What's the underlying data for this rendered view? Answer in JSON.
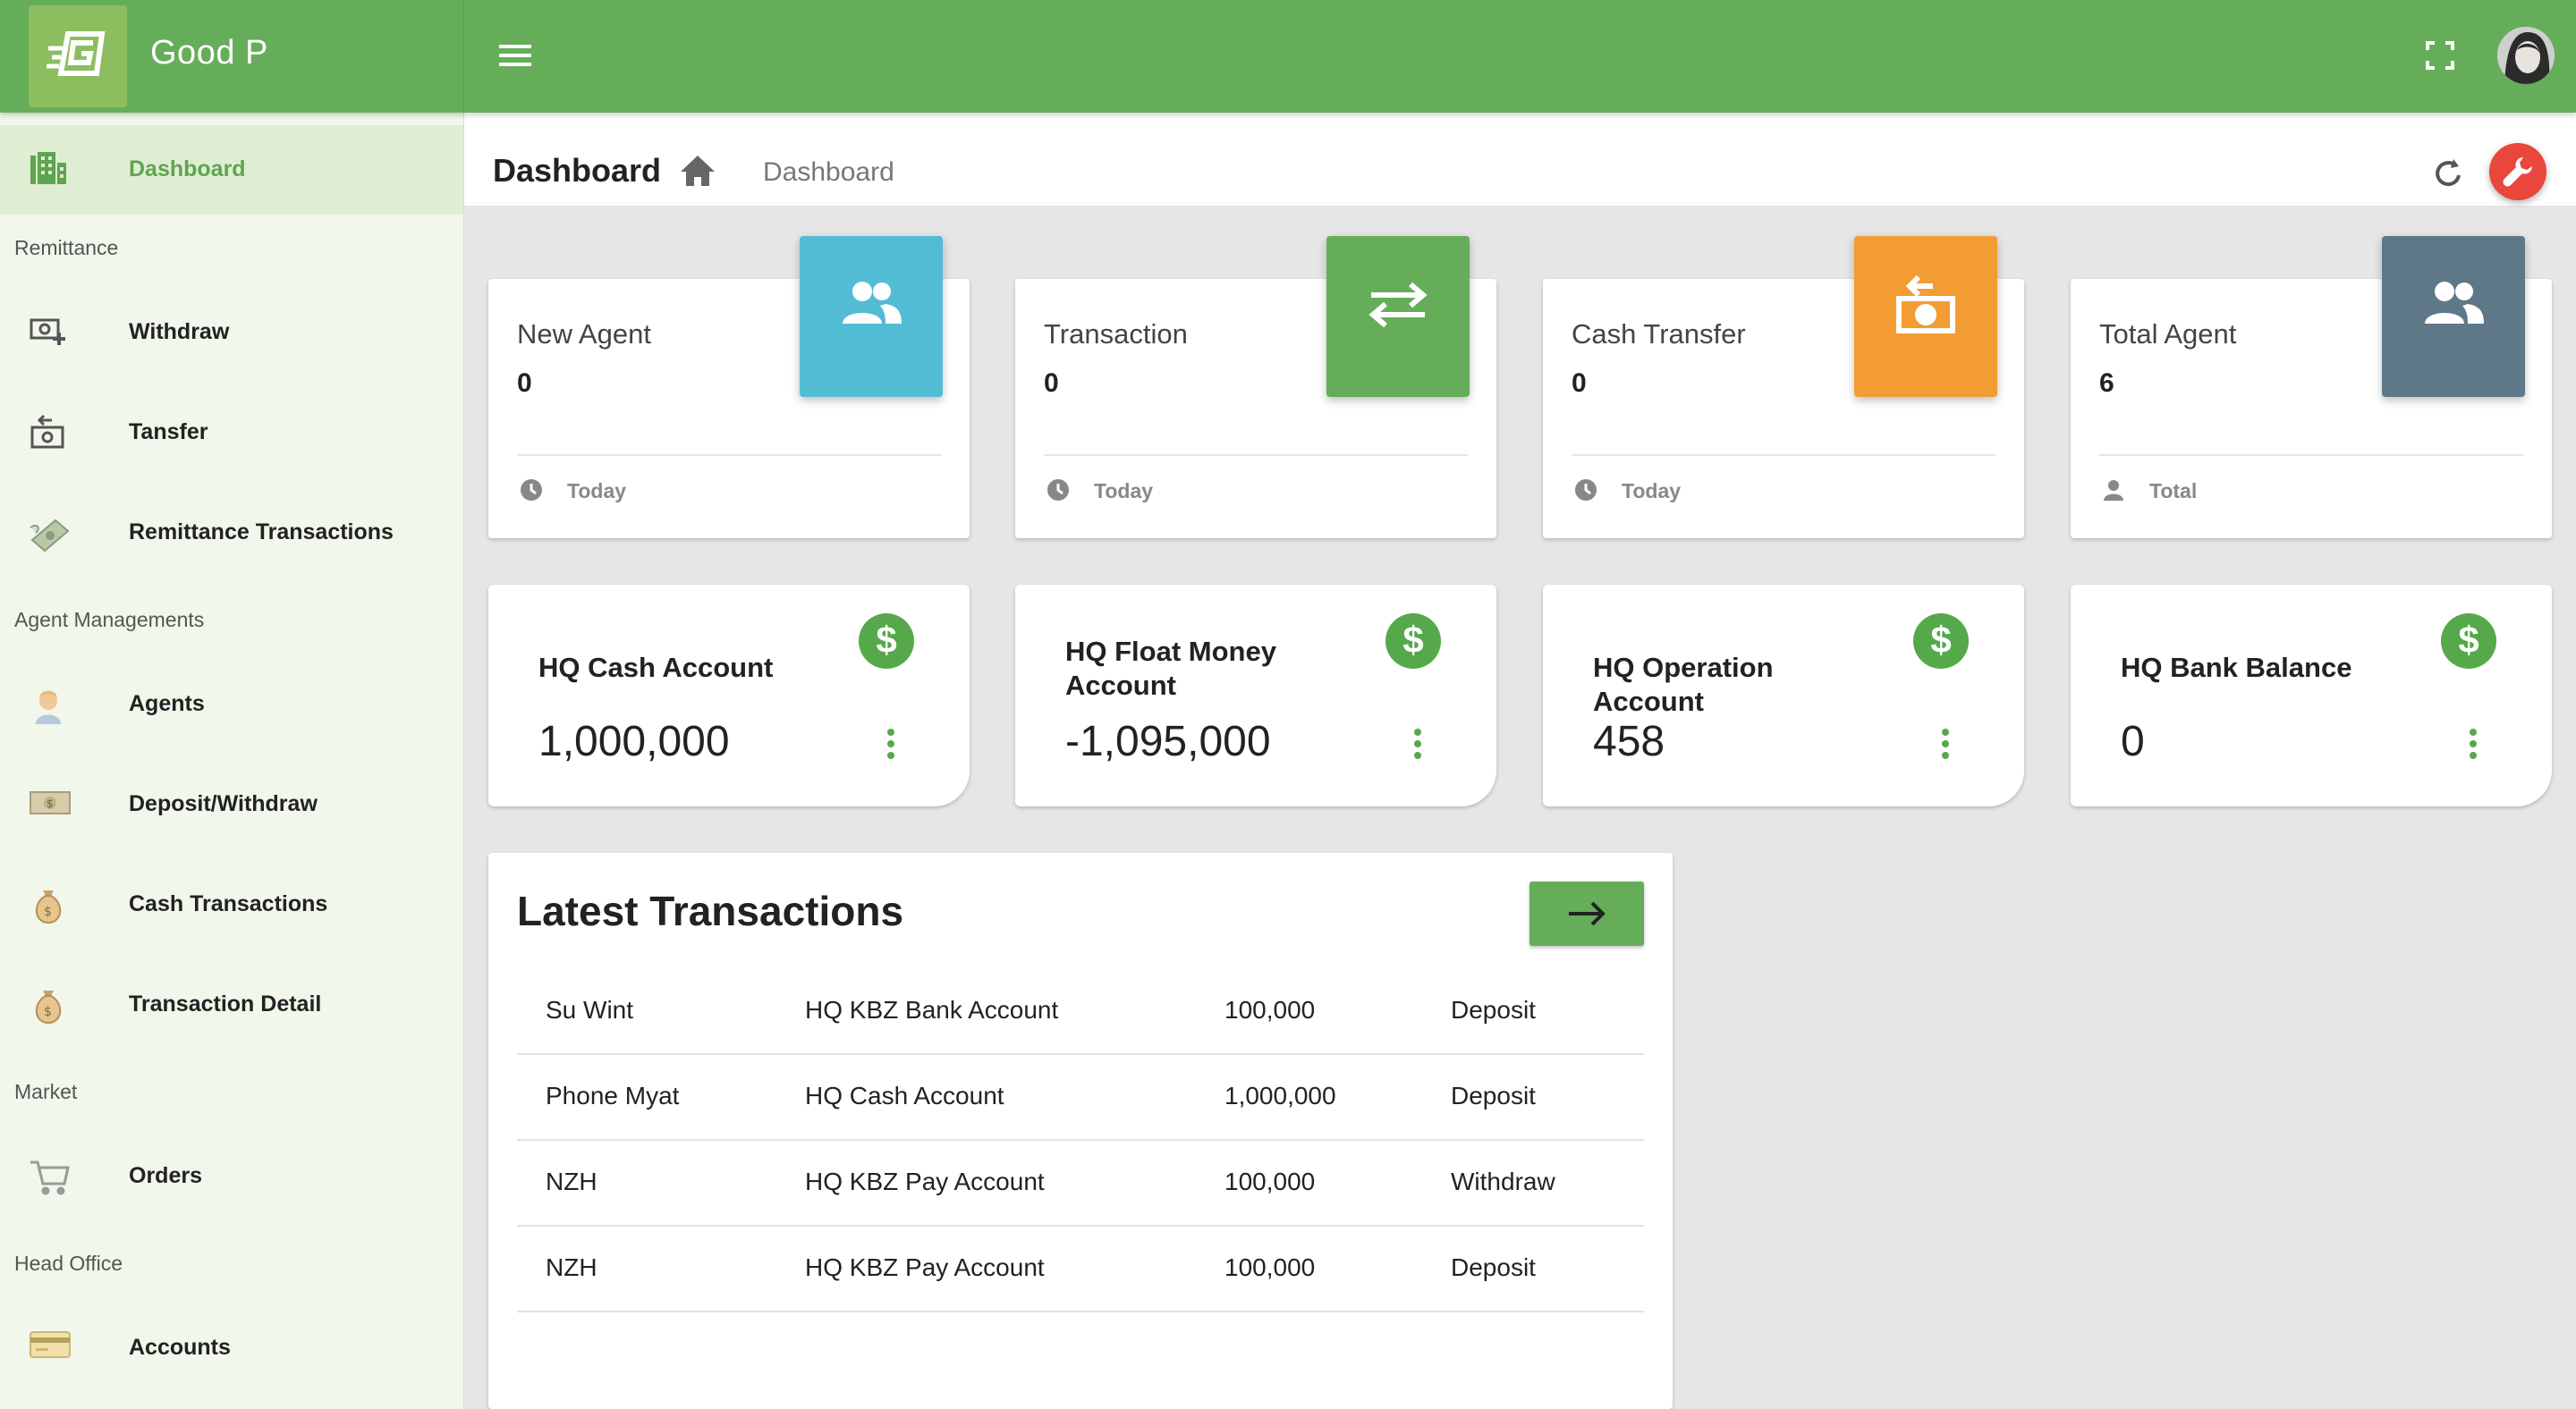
{
  "app": {
    "name": "Good P"
  },
  "colors": {
    "primary": "#66ad5a",
    "sidebar_bg": "#f1f7ea",
    "agent_blue": "#53bcd5",
    "transaction_green": "#66ad5a",
    "cash_orange": "#f39c34",
    "total_slate": "#5f7888",
    "danger_red": "#e9463c"
  },
  "sidebar": {
    "dashboard": "Dashboard",
    "sections": {
      "remittance": "Remittance",
      "agent": "Agent Managements",
      "market": "Market",
      "head_office": "Head Office"
    },
    "items": {
      "withdraw": "Withdraw",
      "transfer": "Tansfer",
      "remittance_tx": "Remittance Transactions",
      "agents": "Agents",
      "deposit_withdraw": "Deposit/Withdraw",
      "cash_tx": "Cash Transactions",
      "tx_detail": "Transaction Detail",
      "orders": "Orders",
      "accounts": "Accounts"
    }
  },
  "header": {
    "title": "Dashboard",
    "breadcrumb": "Dashboard"
  },
  "stats": {
    "new_agent": {
      "title": "New Agent",
      "value": "0",
      "footer": "Today",
      "icon": "people-icon"
    },
    "transaction": {
      "title": "Transaction",
      "value": "0",
      "footer": "Today",
      "icon": "swap-icon"
    },
    "cash_transfer": {
      "title": "Cash Transfer",
      "value": "0",
      "footer": "Today",
      "icon": "cash-transfer-icon"
    },
    "total_agent": {
      "title": "Total Agent",
      "value": "6",
      "footer": "Total",
      "icon": "people-icon"
    }
  },
  "accounts": {
    "cash": {
      "name": "HQ Cash Account",
      "amount": "1,000,000"
    },
    "float": {
      "name": "HQ Float Money Account",
      "amount": "-1,095,000"
    },
    "operation": {
      "name": "HQ Operation Account",
      "amount": "458"
    },
    "bank": {
      "name": "HQ Bank Balance",
      "amount": "0"
    },
    "currency_symbol": "$"
  },
  "latest": {
    "title": "Latest Transactions",
    "rows": [
      {
        "name": "Su Wint",
        "account": "HQ KBZ Bank Account",
        "amount": "100,000",
        "type": "Deposit"
      },
      {
        "name": "Phone Myat",
        "account": "HQ Cash Account",
        "amount": "1,000,000",
        "type": "Deposit"
      },
      {
        "name": "NZH",
        "account": "HQ KBZ Pay Account",
        "amount": "100,000",
        "type": "Withdraw"
      },
      {
        "name": "NZH",
        "account": "HQ KBZ Pay Account",
        "amount": "100,000",
        "type": "Deposit"
      }
    ]
  }
}
